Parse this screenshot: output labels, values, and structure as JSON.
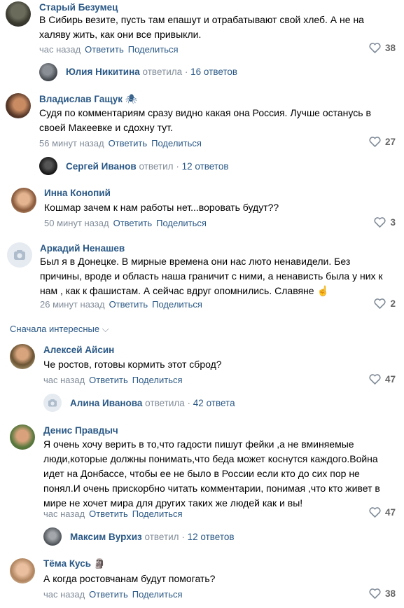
{
  "comments": [
    {
      "name": "Старый Безумец",
      "lines": [
        "В Сибирь везите, пусть там епашут и отрабатывают свой хлеб. А не на",
        "халяву жить, как они все привыкли."
      ],
      "time": "час назад",
      "reply_label": "Ответить",
      "share_label": "Поделиться",
      "likes": "38",
      "thread": {
        "name": "Юлия Никитина",
        "verb": "ответила",
        "count": "16 ответов"
      }
    },
    {
      "name": "Владислав Гащук",
      "badge": "🕷",
      "lines": [
        "Судя по комментариям сразу видно какая она Россия. Лучше останусь в",
        "своей Макеевке и сдохну тут."
      ],
      "time": "56 минут назад",
      "reply_label": "Ответить",
      "share_label": "Поделиться",
      "likes": "27",
      "thread": {
        "name": "Сергей Иванов",
        "verb": "ответил",
        "count": "12 ответов"
      }
    },
    {
      "name": "Инна Конопий",
      "lines": [
        "Кошмар зачем к нам работы нет...воровать будут??"
      ],
      "time": "50 минут назад",
      "reply_label": "Ответить",
      "share_label": "Поделиться",
      "likes": "3"
    },
    {
      "name": "Аркадий Ненашев",
      "lines": [
        "Был я в Донецке. В мирные времена они нас люто ненавидели. Без",
        "причины, вроде и область наша граничит с ними, а ненависть была у них к",
        "нам , как к фашистам. А сейчас вдруг опомнились. Славяне ☝"
      ],
      "time": "26 минут назад",
      "reply_label": "Ответить",
      "share_label": "Поделиться",
      "likes": "2"
    },
    {
      "name": "Алексей Айсин",
      "lines": [
        "Че ростов, готовы кормить этот сброд?"
      ],
      "time": "час назад",
      "reply_label": "Ответить",
      "share_label": "Поделиться",
      "likes": "47",
      "thread": {
        "name": "Алина Иванова",
        "verb": "ответила",
        "count": "42 ответа"
      }
    },
    {
      "name": "Денис Правдыч",
      "lines": [
        "Я очень хочу верить в то,что гадости пишут фейки ,а не вминяемые",
        "люди,которые должны понимать,что беда может коснутся каждого.Война",
        "идет на Донбассе, чтобы ее не было в России если кто до сих пор не",
        "понял.И очень прискорбно читать комментарии, понимая ,что кто живет в",
        "мире не хочет мира для других таких же людей как и вы!"
      ],
      "time": "час назад",
      "reply_label": "Ответить",
      "share_label": "Поделиться",
      "likes": "47",
      "thread": {
        "name": "Максим Вурхиз",
        "verb": "ответил",
        "count": "12 ответов"
      }
    },
    {
      "name": "Тёма Кусь",
      "badge": "🗿",
      "lines": [
        "А когда ростовчанам будут помогать?"
      ],
      "time": "час назад",
      "reply_label": "Ответить",
      "share_label": "Поделиться",
      "likes": "38"
    }
  ],
  "sort_label": "Сначала интересные",
  "colors": {
    "link": "#2a5885",
    "meta": "#818c99",
    "like": "#656565"
  }
}
